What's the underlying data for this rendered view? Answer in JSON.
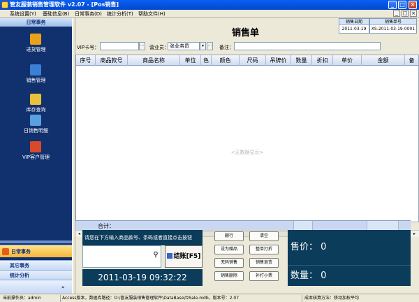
{
  "window": {
    "title": "管友服装销售管理软件 v2.07 - [Pos销售]"
  },
  "menu": [
    "系统设置(Y)",
    "基础信息(B)",
    "日常事务(D)",
    "统计分析(T)",
    "帮助文件(H)"
  ],
  "sidebar": {
    "header": "日常事务",
    "items": [
      {
        "label": "进货管理",
        "color": "#e8a21a"
      },
      {
        "label": "销售管理",
        "color": "#3b7fd6"
      },
      {
        "label": "库存查询",
        "color": "#e8c23a"
      },
      {
        "label": "日销售明细",
        "color": "#5aa0e0"
      },
      {
        "label": "VIP客户管理",
        "color": "#d84a2a"
      }
    ],
    "sections": [
      "日常事务",
      "其它事务",
      "统计分析"
    ],
    "more": "»"
  },
  "form": {
    "title": "销售单",
    "date_label": "销售日期",
    "date_value": "2011-03-19",
    "no_label": "销售单号",
    "no_value": "XS-2011-03-19-0001",
    "vip_label": "VIP卡号：",
    "vip_value": "",
    "clerk_label": "营业员：",
    "clerk_value": "张业务员",
    "note_label": "备注：",
    "note_value": ""
  },
  "grid": {
    "columns": [
      "序号",
      "商品款号",
      "商品名称",
      "单位",
      "色",
      "颜色",
      "尺码",
      "吊牌价",
      "数量",
      "折扣",
      "单价",
      "金额",
      "备"
    ],
    "empty_text": "<无数据显示>",
    "sum_label": "合计："
  },
  "pos": {
    "prompt": "请您在下方输入商品款号、条码或者直接点击按钮",
    "code_value": "",
    "find_icon": "binoculars-icon",
    "pay_label": "结账[F5]",
    "clock": "2011-03-19 09:32:22",
    "buttons": [
      "删行",
      "清空",
      "设为赠品",
      "整单打折",
      "无码销售",
      "销售退货",
      "销售删除",
      "补打小票"
    ],
    "price_label": "售价：",
    "price_value": "0",
    "qty_label": "数量：",
    "qty_value": "0"
  },
  "status": {
    "operator": "当前操作员：admin",
    "db": "Access版本，数据库路径：D:\\管友服装销售管理软件\\DataBase\\fzSale.mdb，版本号：2.07",
    "cost": "成本核算方法：移动加权平均"
  }
}
